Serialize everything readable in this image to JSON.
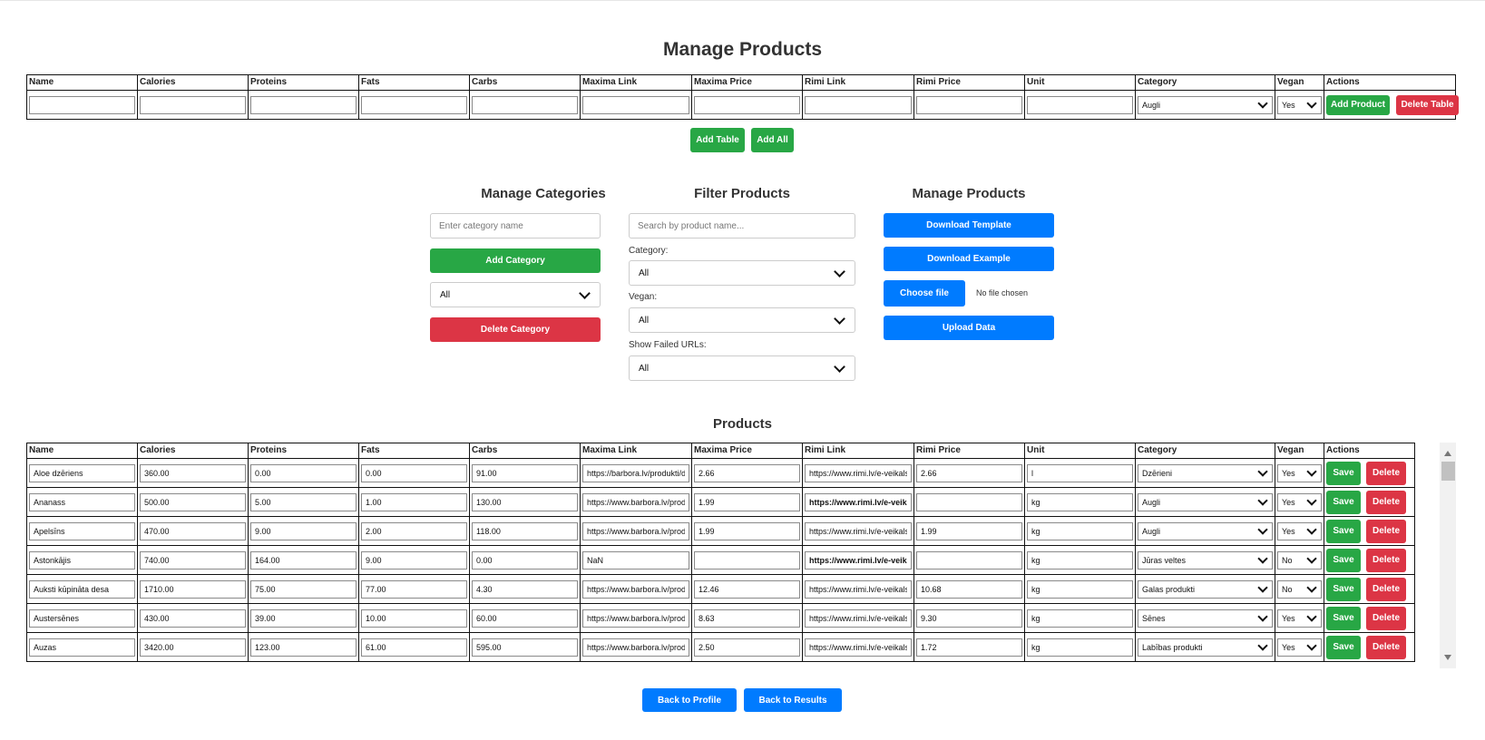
{
  "page_title": "Manage Products",
  "columns": [
    "Name",
    "Calories",
    "Proteins",
    "Fats",
    "Carbs",
    "Maxima Link",
    "Maxima Price",
    "Rimi Link",
    "Rimi Price",
    "Unit",
    "Category",
    "Vegan",
    "Actions"
  ],
  "add_row": {
    "category": "Augli",
    "vegan": "Yes",
    "add_product_label": "Add Product",
    "delete_table_label": "Delete Table"
  },
  "add_table_label": "Add Table",
  "add_all_label": "Add All",
  "manage_categories": {
    "title": "Manage Categories",
    "input_placeholder": "Enter category name",
    "add_button": "Add Category",
    "selected": "All",
    "delete_button": "Delete Category"
  },
  "filter_products": {
    "title": "Filter Products",
    "search_placeholder": "Search by product name...",
    "category_label": "Category:",
    "category_value": "All",
    "vegan_label": "Vegan:",
    "vegan_value": "All",
    "failed_label": "Show Failed URLs:",
    "failed_value": "All"
  },
  "manage_products_panel": {
    "title": "Manage Products",
    "download_template": "Download Template",
    "download_example": "Download Example",
    "choose_file": "Choose file",
    "no_file": "No file chosen",
    "upload_data": "Upload Data"
  },
  "products_title": "Products",
  "products": [
    {
      "name": "Aloe dzēriens",
      "calories": "360.00",
      "proteins": "0.00",
      "fats": "0.00",
      "carbs": "91.00",
      "maxima_link": "https://barbora.lv/produkti/dz",
      "maxima_price": "2.66",
      "rimi_link": "https://www.rimi.lv/e-veikals",
      "rimi_failed": false,
      "rimi_price": "2.66",
      "unit": "l",
      "category": "Dzērieni",
      "vegan": "Yes"
    },
    {
      "name": "Ananass",
      "calories": "500.00",
      "proteins": "5.00",
      "fats": "1.00",
      "carbs": "130.00",
      "maxima_link": "https://www.barbora.lv/produ",
      "maxima_price": "1.99",
      "rimi_link": "https://www.rimi.lv/e-veikals",
      "rimi_failed": true,
      "rimi_price": "",
      "unit": "kg",
      "category": "Augli",
      "vegan": "Yes"
    },
    {
      "name": "Apelsīns",
      "calories": "470.00",
      "proteins": "9.00",
      "fats": "2.00",
      "carbs": "118.00",
      "maxima_link": "https://www.barbora.lv/produ",
      "maxima_price": "1.99",
      "rimi_link": "https://www.rimi.lv/e-veikals",
      "rimi_failed": false,
      "rimi_price": "1.99",
      "unit": "kg",
      "category": "Augli",
      "vegan": "Yes"
    },
    {
      "name": "Astonkājis",
      "calories": "740.00",
      "proteins": "164.00",
      "fats": "9.00",
      "carbs": "0.00",
      "maxima_link": "NaN",
      "maxima_price": "",
      "rimi_link": "https://www.rimi.lv/e-veikals",
      "rimi_failed": true,
      "rimi_price": "",
      "unit": "kg",
      "category": "Jūras veltes",
      "vegan": "No"
    },
    {
      "name": "Auksti kūpināta desa",
      "calories": "1710.00",
      "proteins": "75.00",
      "fats": "77.00",
      "carbs": "4.30",
      "maxima_link": "https://www.barbora.lv/produ",
      "maxima_price": "12.46",
      "rimi_link": "https://www.rimi.lv/e-veikals",
      "rimi_failed": false,
      "rimi_price": "10.68",
      "unit": "kg",
      "category": "Galas produkti",
      "vegan": "No"
    },
    {
      "name": "Austersēnes",
      "calories": "430.00",
      "proteins": "39.00",
      "fats": "10.00",
      "carbs": "60.00",
      "maxima_link": "https://www.barbora.lv/produ",
      "maxima_price": "8.63",
      "rimi_link": "https://www.rimi.lv/e-veikals",
      "rimi_failed": false,
      "rimi_price": "9.30",
      "unit": "kg",
      "category": "Sēnes",
      "vegan": "Yes"
    },
    {
      "name": "Auzas",
      "calories": "3420.00",
      "proteins": "123.00",
      "fats": "61.00",
      "carbs": "595.00",
      "maxima_link": "https://www.barbora.lv/produ",
      "maxima_price": "2.50",
      "rimi_link": "https://www.rimi.lv/e-veikals",
      "rimi_failed": false,
      "rimi_price": "1.72",
      "unit": "kg",
      "category": "Labības produkti",
      "vegan": "Yes"
    }
  ],
  "save_label": "Save",
  "delete_label": "Delete",
  "back_to_profile": "Back to Profile",
  "back_to_results": "Back to Results",
  "colors": {
    "green": "#28a745",
    "red": "#dc3545",
    "blue": "#007bff",
    "failed": "#ff0000"
  }
}
